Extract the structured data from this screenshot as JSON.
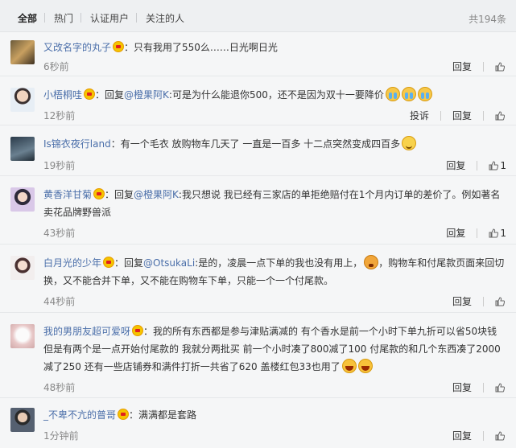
{
  "tabs": {
    "all": "全部",
    "hot": "热门",
    "verified": "认证用户",
    "following": "关注的人",
    "total": "共194条"
  },
  "colors": {
    "accent": "#eb7350",
    "link": "#4a6ea9",
    "meta": "#888888"
  },
  "actions": {
    "report": "投诉",
    "reply": "回复"
  },
  "comments": [
    {
      "user": "又改名字的丸子",
      "body": "：只有我用了550么……日光啊日光",
      "time": "6秒前",
      "likes": ""
    },
    {
      "user": "小梧桐哇",
      "prefix": "：回复",
      "mention": "@橙果阿K",
      "body": ":可是为什么能退你500，还不是因为双十一要降价",
      "emoji": "cry-icon",
      "time": "12秒前",
      "likes": ""
    },
    {
      "user": "Is锦衣夜行land",
      "body": "：有一个毛衣 放购物车几天了 一直是一百多 十二点突然变成四百多",
      "emoji": "smile-icon",
      "time": "19秒前",
      "likes": "1"
    },
    {
      "user": "黄香洋甘菊",
      "prefix": "：回复",
      "mention": "@橙果阿K",
      "body": ":我只想说 我已经有三家店的单拒绝赔付在1个月内订单的差价了。例如著名卖花品牌野兽派",
      "time": "43秒前",
      "likes": "1"
    },
    {
      "user": "白月光的少年",
      "prefix": "：回复",
      "mention": "@OtsukaLi",
      "body1": ":是的，凌晨一点下单的我也没有用上，",
      "body2": "，购物车和付尾款页面来回切换，又不能合并下单，又不能在购物车下单，只能一个一个付尾款。",
      "emoji": "angry-icon",
      "time": "44秒前",
      "likes": ""
    },
    {
      "user": "我的男朋友超可爱呀",
      "body": "：我的所有东西都是参与津贴满减的 有个香水是前一个小时下单九折可以省50块钱但是有两个是一点开始付尾款的 我就分两批买 前一个小时凑了800减了100 付尾款的和几个东西凑了2000减了250 还有一些店铺券和满件打折一共省了620 盖楼红包33也用了",
      "emoji": "laugh-icon",
      "time": "48秒前",
      "likes": ""
    },
    {
      "user": "_不卑不亢的普哥",
      "body": "：满满都是套路",
      "time": "1分钟前",
      "likes": ""
    }
  ]
}
